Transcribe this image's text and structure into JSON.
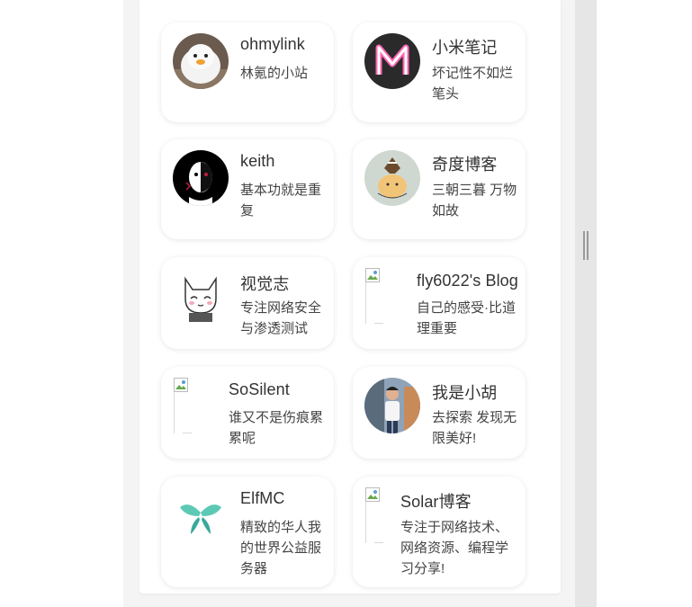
{
  "links": [
    {
      "name": "ohmylink",
      "desc": "林氪的小站",
      "avatar": "duck-avatar"
    },
    {
      "name": "小米笔记",
      "desc": "坏记性不如烂笔头",
      "avatar": "letter-m-avatar"
    },
    {
      "name": "keith",
      "desc": "基本功就是重复",
      "avatar": "face-avatar"
    },
    {
      "name": "奇度博客",
      "desc": "三朝三暮 万物如故",
      "avatar": "cartoon-avatar"
    },
    {
      "name": "视觉志",
      "desc": "专注网络安全与渗透测试",
      "avatar": "cat-avatar"
    },
    {
      "name": "fly6022's Blog",
      "desc": "自己的感受·比道理重要",
      "avatar": "broken-image"
    },
    {
      "name": "SoSilent",
      "desc": "谁又不是伤痕累累呢",
      "avatar": "broken-image"
    },
    {
      "name": "我是小胡",
      "desc": "去探索 发现无限美好!",
      "avatar": "photo-avatar"
    },
    {
      "name": "ElfMC",
      "desc": "精致的华人我的世界公益服务器",
      "avatar": "butterfly-avatar"
    },
    {
      "name": "Solar博客",
      "desc": "专注于网络技术、网络资源、编程学习分享!",
      "avatar": "broken-image"
    }
  ]
}
